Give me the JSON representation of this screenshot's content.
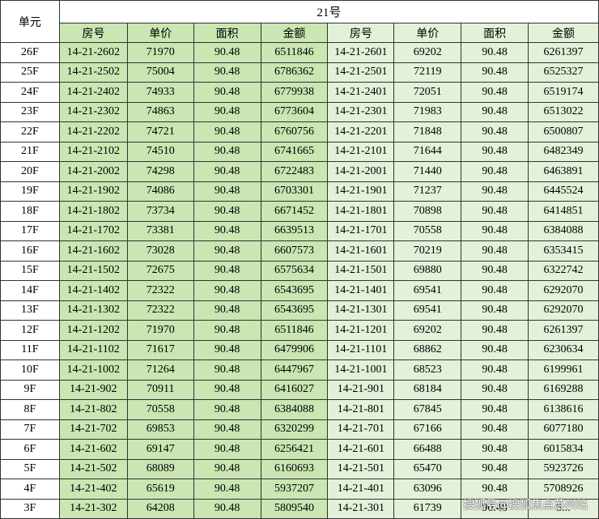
{
  "table": {
    "unit_header": "单元",
    "building_header": "21号",
    "col_headers": [
      "房号",
      "单价",
      "面积",
      "金额",
      "房号",
      "单价",
      "面积",
      "金额"
    ],
    "rows": [
      {
        "floor": "26F",
        "room_a": "14-21-2602",
        "price_a": "71970",
        "area_a": "90.48",
        "total_a": "6511846",
        "room_b": "14-21-2601",
        "price_b": "69202",
        "area_b": "90.48",
        "total_b": "6261397"
      },
      {
        "floor": "25F",
        "room_a": "14-21-2502",
        "price_a": "75004",
        "area_a": "90.48",
        "total_a": "6786362",
        "room_b": "14-21-2501",
        "price_b": "72119",
        "area_b": "90.48",
        "total_b": "6525327"
      },
      {
        "floor": "24F",
        "room_a": "14-21-2402",
        "price_a": "74933",
        "area_a": "90.48",
        "total_a": "6779938",
        "room_b": "14-21-2401",
        "price_b": "72051",
        "area_b": "90.48",
        "total_b": "6519174"
      },
      {
        "floor": "23F",
        "room_a": "14-21-2302",
        "price_a": "74863",
        "area_a": "90.48",
        "total_a": "6773604",
        "room_b": "14-21-2301",
        "price_b": "71983",
        "area_b": "90.48",
        "total_b": "6513022"
      },
      {
        "floor": "22F",
        "room_a": "14-21-2202",
        "price_a": "74721",
        "area_a": "90.48",
        "total_a": "6760756",
        "room_b": "14-21-2201",
        "price_b": "71848",
        "area_b": "90.48",
        "total_b": "6500807"
      },
      {
        "floor": "21F",
        "room_a": "14-21-2102",
        "price_a": "74510",
        "area_a": "90.48",
        "total_a": "6741665",
        "room_b": "14-21-2101",
        "price_b": "71644",
        "area_b": "90.48",
        "total_b": "6482349"
      },
      {
        "floor": "20F",
        "room_a": "14-21-2002",
        "price_a": "74298",
        "area_a": "90.48",
        "total_a": "6722483",
        "room_b": "14-21-2001",
        "price_b": "71440",
        "area_b": "90.48",
        "total_b": "6463891"
      },
      {
        "floor": "19F",
        "room_a": "14-21-1902",
        "price_a": "74086",
        "area_a": "90.48",
        "total_a": "6703301",
        "room_b": "14-21-1901",
        "price_b": "71237",
        "area_b": "90.48",
        "total_b": "6445524"
      },
      {
        "floor": "18F",
        "room_a": "14-21-1802",
        "price_a": "73734",
        "area_a": "90.48",
        "total_a": "6671452",
        "room_b": "14-21-1801",
        "price_b": "70898",
        "area_b": "90.48",
        "total_b": "6414851"
      },
      {
        "floor": "17F",
        "room_a": "14-21-1702",
        "price_a": "73381",
        "area_a": "90.48",
        "total_a": "6639513",
        "room_b": "14-21-1701",
        "price_b": "70558",
        "area_b": "90.48",
        "total_b": "6384088"
      },
      {
        "floor": "16F",
        "room_a": "14-21-1602",
        "price_a": "73028",
        "area_a": "90.48",
        "total_a": "6607573",
        "room_b": "14-21-1601",
        "price_b": "70219",
        "area_b": "90.48",
        "total_b": "6353415"
      },
      {
        "floor": "15F",
        "room_a": "14-21-1502",
        "price_a": "72675",
        "area_a": "90.48",
        "total_a": "6575634",
        "room_b": "14-21-1501",
        "price_b": "69880",
        "area_b": "90.48",
        "total_b": "6322742"
      },
      {
        "floor": "14F",
        "room_a": "14-21-1402",
        "price_a": "72322",
        "area_a": "90.48",
        "total_a": "6543695",
        "room_b": "14-21-1401",
        "price_b": "69541",
        "area_b": "90.48",
        "total_b": "6292070"
      },
      {
        "floor": "13F",
        "room_a": "14-21-1302",
        "price_a": "72322",
        "area_a": "90.48",
        "total_a": "6543695",
        "room_b": "14-21-1301",
        "price_b": "69541",
        "area_b": "90.48",
        "total_b": "6292070"
      },
      {
        "floor": "12F",
        "room_a": "14-21-1202",
        "price_a": "71970",
        "area_a": "90.48",
        "total_a": "6511846",
        "room_b": "14-21-1201",
        "price_b": "69202",
        "area_b": "90.48",
        "total_b": "6261397"
      },
      {
        "floor": "11F",
        "room_a": "14-21-1102",
        "price_a": "71617",
        "area_a": "90.48",
        "total_a": "6479906",
        "room_b": "14-21-1101",
        "price_b": "68862",
        "area_b": "90.48",
        "total_b": "6230634"
      },
      {
        "floor": "10F",
        "room_a": "14-21-1002",
        "price_a": "71264",
        "area_a": "90.48",
        "total_a": "6447967",
        "room_b": "14-21-1001",
        "price_b": "68523",
        "area_b": "90.48",
        "total_b": "6199961"
      },
      {
        "floor": "9F",
        "room_a": "14-21-902",
        "price_a": "70911",
        "area_a": "90.48",
        "total_a": "6416027",
        "room_b": "14-21-901",
        "price_b": "68184",
        "area_b": "90.48",
        "total_b": "6169288"
      },
      {
        "floor": "8F",
        "room_a": "14-21-802",
        "price_a": "70558",
        "area_a": "90.48",
        "total_a": "6384088",
        "room_b": "14-21-801",
        "price_b": "67845",
        "area_b": "90.48",
        "total_b": "6138616"
      },
      {
        "floor": "7F",
        "room_a": "14-21-702",
        "price_a": "69853",
        "area_a": "90.48",
        "total_a": "6320299",
        "room_b": "14-21-701",
        "price_b": "67166",
        "area_b": "90.48",
        "total_b": "6077180"
      },
      {
        "floor": "6F",
        "room_a": "14-21-602",
        "price_a": "69147",
        "area_a": "90.48",
        "total_a": "6256421",
        "room_b": "14-21-601",
        "price_b": "66488",
        "area_b": "90.48",
        "total_b": "6015834"
      },
      {
        "floor": "5F",
        "room_a": "14-21-502",
        "price_a": "68089",
        "area_a": "90.48",
        "total_a": "6160693",
        "room_b": "14-21-501",
        "price_b": "65470",
        "area_b": "90.48",
        "total_b": "5923726"
      },
      {
        "floor": "4F",
        "room_a": "14-21-402",
        "price_a": "65619",
        "area_a": "90.48",
        "total_a": "5937207",
        "room_b": "14-21-401",
        "price_b": "63096",
        "area_b": "90.48",
        "total_b": "5708926"
      },
      {
        "floor": "3F",
        "room_a": "14-21-302",
        "price_a": "64208",
        "area_a": "90.48",
        "total_a": "5809540",
        "room_b": "14-21-301",
        "price_b": "61739",
        "area_b": "90.48",
        "total_b": "5..."
      }
    ]
  },
  "watermark": "搜狐号@搜狐焦点苏州站",
  "colors": {
    "green_dark": "#c9e6b3",
    "green_light": "#e3f1d8",
    "border": "#333333"
  }
}
